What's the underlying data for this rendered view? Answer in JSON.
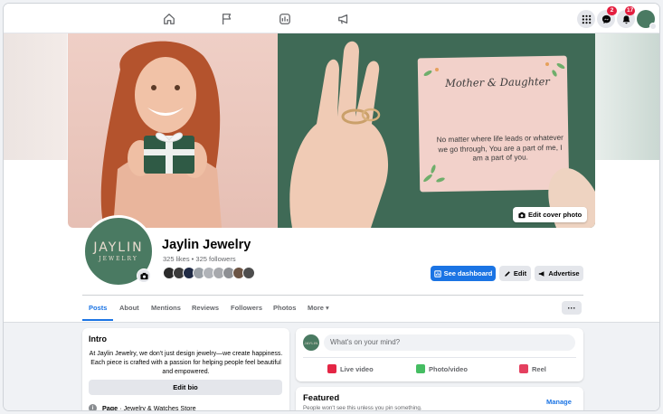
{
  "nav": {
    "center_icons": [
      "home-icon",
      "flag-icon",
      "ads-icon",
      "megaphone-icon"
    ],
    "messenger_badge": "2",
    "notifications_badge": "17"
  },
  "cover": {
    "card_title": "Mother & Daughter",
    "card_text": "No matter where life leads or whatever we go through, You are a part of me, I am a part of you.",
    "edit_cover_label": "Edit cover photo"
  },
  "profile": {
    "logo_name": "JAYLIN",
    "logo_sub": "JEWELRY",
    "name": "Jaylin Jewelry",
    "stats": "325 likes • 325 followers",
    "follower_face_colors": [
      "#2b2b2b",
      "#3a3a3a",
      "#1f2a44",
      "#9aa0a6",
      "#b0b3b8",
      "#a7a9ad",
      "#8d8f93",
      "#6b5444",
      "#4d4d4d"
    ]
  },
  "actions": {
    "dashboard": "See dashboard",
    "edit": "Edit",
    "advertise": "Advertise"
  },
  "tabs": [
    {
      "label": "Posts",
      "active": true
    },
    {
      "label": "About"
    },
    {
      "label": "Mentions"
    },
    {
      "label": "Reviews"
    },
    {
      "label": "Followers"
    },
    {
      "label": "Photos"
    },
    {
      "label": "More ▾"
    }
  ],
  "more_menu": "···",
  "intro": {
    "title": "Intro",
    "text": "At Jaylin Jewelry, we don't just design jewelry—we create happiness. Each piece is crafted with a passion for helping people feel beautiful and empowered.",
    "edit_bio": "Edit bio",
    "page_label": "Page",
    "page_category": " · Jewelry & Watches Store"
  },
  "composer": {
    "avatar_text": "JAYLIN",
    "placeholder": "What's on your mind?",
    "live": "Live video",
    "photo": "Photo/video",
    "reel": "Reel"
  },
  "featured": {
    "title": "Featured",
    "subtitle": "People won't see this unless you pin something.",
    "manage": "Manage"
  },
  "colors": {
    "accent": "#1b74e4",
    "brand_green": "#4a7a62",
    "live": "#e42645",
    "photo": "#45bd62",
    "reel": "#e4405f"
  }
}
